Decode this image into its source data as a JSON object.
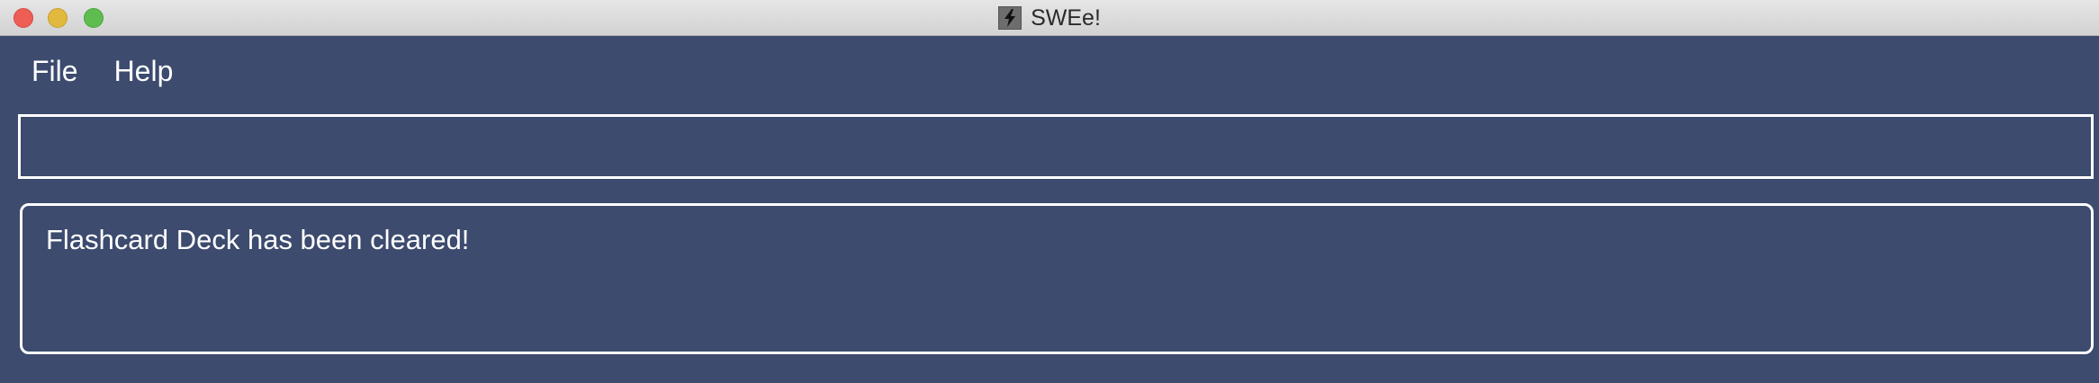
{
  "window": {
    "title": "SWEe!",
    "app_icon": "lightning-bolt-icon"
  },
  "menubar": {
    "items": [
      {
        "label": "File"
      },
      {
        "label": "Help"
      }
    ]
  },
  "command_box": {
    "value": "",
    "placeholder": ""
  },
  "result_display": {
    "text": "Flashcard Deck has been cleared!"
  },
  "colors": {
    "background": "#3c4b6e",
    "border": "#ffffff",
    "text": "#ffffff"
  }
}
